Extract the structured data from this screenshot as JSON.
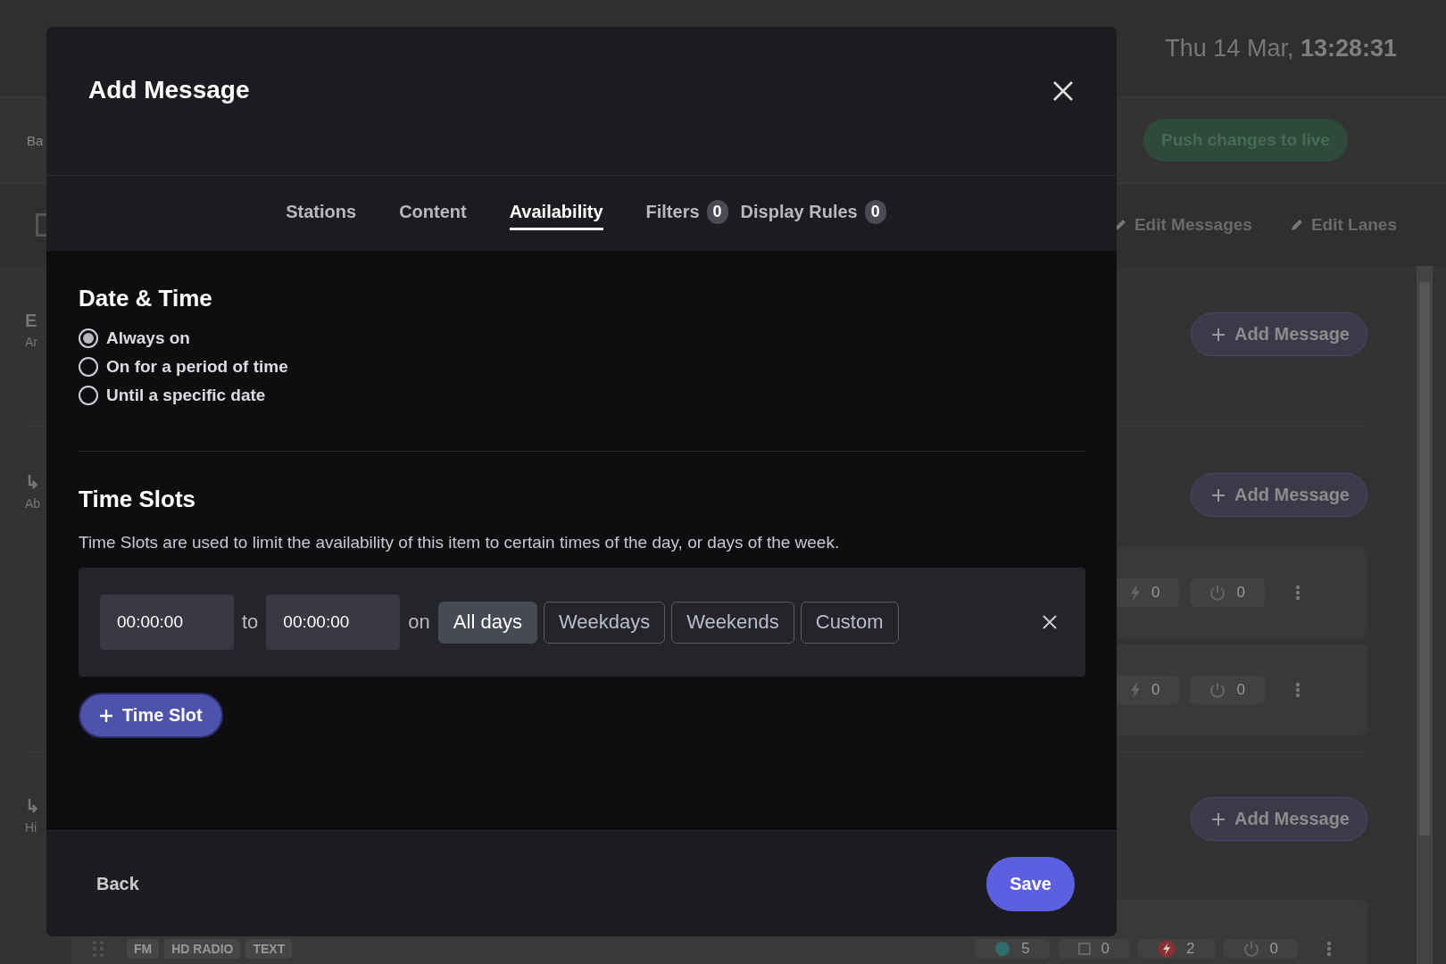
{
  "page": {
    "clock": "Thu 14 Mar, **13:28:31**",
    "breadcrumb": "Ba",
    "push_button": "Push changes to live",
    "toolbar_links": [
      "Edit Messages",
      "Edit Lanes"
    ],
    "sections": [
      {
        "heading": "E",
        "subheading": "Ar",
        "add_button": "Add Message"
      },
      {
        "heading": "↳",
        "subheading": "Ab",
        "add_button": "Add Message",
        "cards": [
          {
            "stats": [
              {
                "kind": "blank"
              },
              {
                "kind": "bolt",
                "value": "0"
              },
              {
                "kind": "power",
                "value": "0"
              }
            ]
          },
          {
            "stats": [
              {
                "kind": "blank"
              },
              {
                "kind": "bolt",
                "value": "0"
              },
              {
                "kind": "power",
                "value": "0"
              }
            ]
          }
        ]
      },
      {
        "heading": "↳",
        "subheading": "Hi",
        "add_button": "Add Message"
      }
    ],
    "bottom_card": {
      "tags": [
        "FM",
        "HD RADIO",
        "TEXT"
      ],
      "stats": [
        {
          "kind": "teal",
          "value": "5"
        },
        {
          "kind": "square",
          "value": "0"
        },
        {
          "kind": "alert",
          "value": "2"
        },
        {
          "kind": "power",
          "value": "0"
        }
      ]
    }
  },
  "dialog": {
    "title": "Add Message",
    "tabs": [
      {
        "label": "Stations",
        "selected": false
      },
      {
        "label": "Content",
        "selected": false
      },
      {
        "label": "Availability",
        "selected": true
      },
      {
        "label": "Filters",
        "badge": "0",
        "selected": false
      },
      {
        "label": "Display Rules",
        "badge": "0",
        "selected": false
      }
    ],
    "date_time": {
      "heading": "Date & Time",
      "options": [
        {
          "label": "Always on",
          "selected": true
        },
        {
          "label": "On for a period of time",
          "selected": false
        },
        {
          "label": "Until a specific date",
          "selected": false
        }
      ]
    },
    "time_slots": {
      "heading": "Time Slots",
      "description": "Time Slots are used to limit the availability of this item to certain times of the day, or days of the week.",
      "slots": [
        {
          "from": "00:00:00",
          "to_word": "to",
          "to": "00:00:00",
          "on_word": "on",
          "days": [
            {
              "label": "All days",
              "selected": true
            },
            {
              "label": "Weekdays",
              "selected": false
            },
            {
              "label": "Weekends",
              "selected": false
            },
            {
              "label": "Custom",
              "selected": false
            }
          ]
        }
      ],
      "add_button": "Time Slot"
    },
    "back_button": "Back",
    "save_button": "Save"
  }
}
